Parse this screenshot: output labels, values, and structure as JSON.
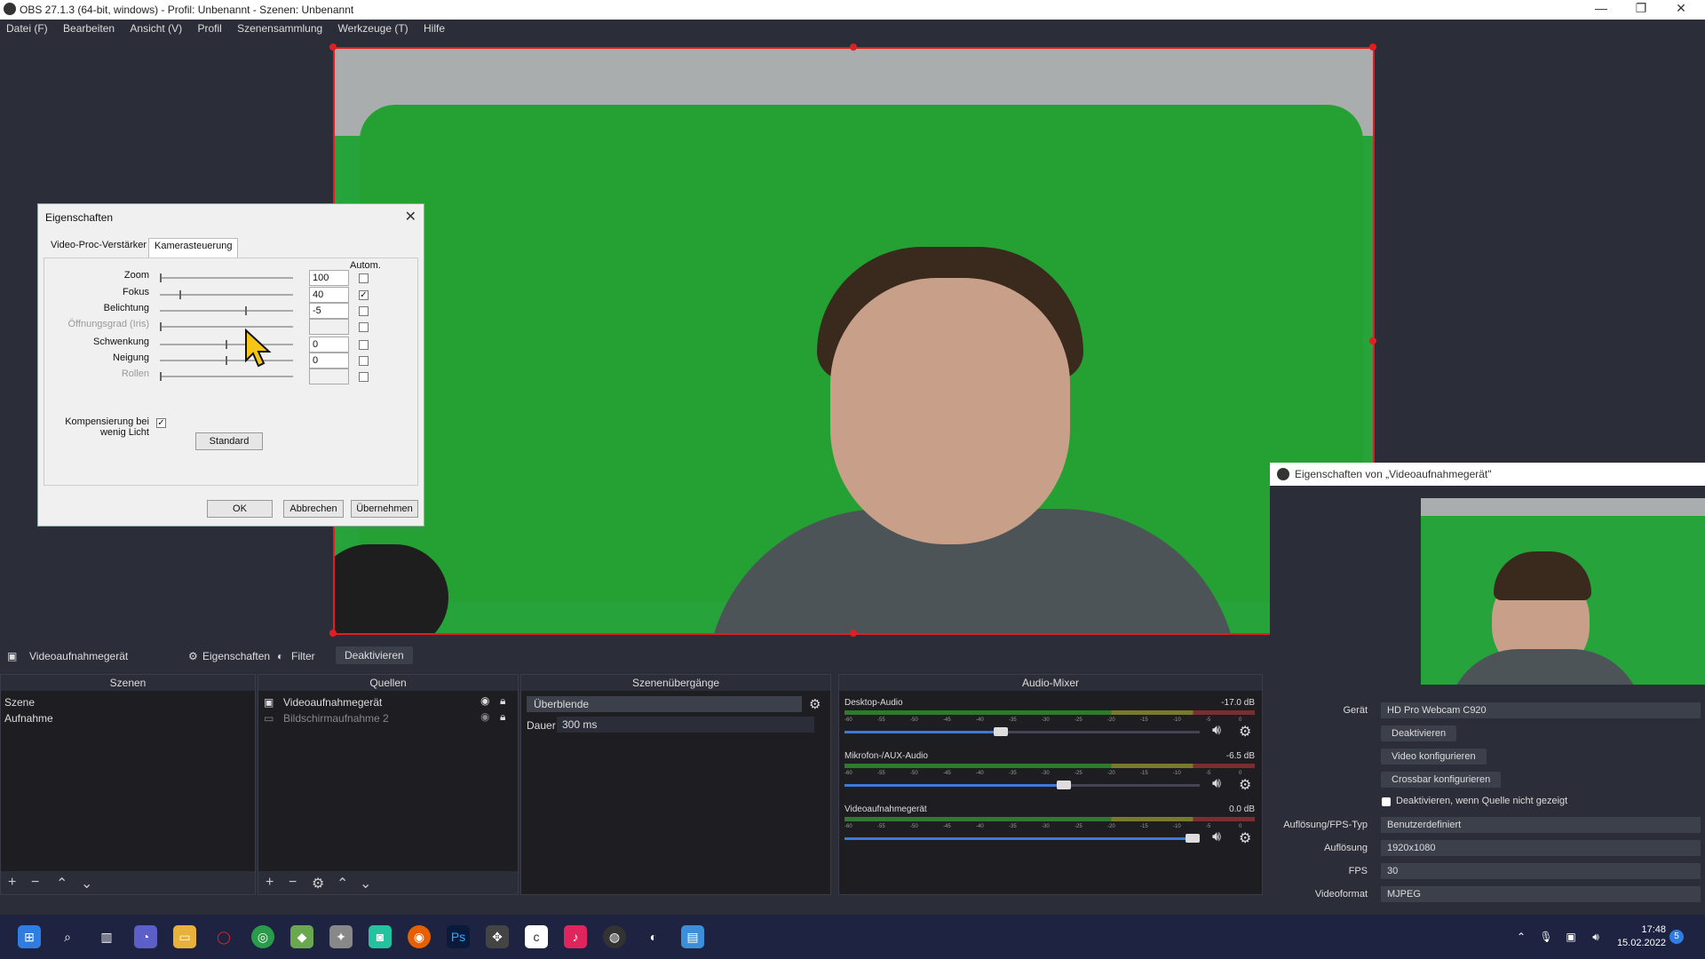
{
  "window": {
    "title": "OBS 27.1.3 (64-bit, windows) - Profil: Unbenannt - Szenen: Unbenannt",
    "controls": [
      "—",
      "❐",
      "✕"
    ]
  },
  "menu": [
    "Datei (F)",
    "Bearbeiten",
    "Ansicht (V)",
    "Profil",
    "Szenensammlung",
    "Werkzeuge (T)",
    "Hilfe"
  ],
  "dialog": {
    "title": "Eigenschaften",
    "tabs": [
      "Video-Proc-Verstärker",
      "Kamerasteuerung"
    ],
    "auto_header": "Autom.",
    "rows": [
      {
        "label": "Zoom",
        "value": "100",
        "checked": false,
        "slider": 0.0,
        "disabled": false
      },
      {
        "label": "Fokus",
        "value": "40",
        "checked": true,
        "slider": 0.15,
        "disabled": false
      },
      {
        "label": "Belichtung",
        "value": "-5",
        "checked": false,
        "slider": 0.65,
        "disabled": false
      },
      {
        "label": "Öffnungsgrad (Iris)",
        "value": "",
        "checked": false,
        "slider": 0.0,
        "disabled": true
      },
      {
        "label": "Schwenkung",
        "value": "0",
        "checked": false,
        "slider": 0.5,
        "disabled": false
      },
      {
        "label": "Neigung",
        "value": "0",
        "checked": false,
        "slider": 0.5,
        "disabled": false
      },
      {
        "label": "Rollen",
        "value": "",
        "checked": false,
        "slider": 0.0,
        "disabled": true
      }
    ],
    "lowlight_label": "Kompensierung bei wenig Licht",
    "lowlight_check": "✓",
    "standard": "Standard",
    "ok": "OK",
    "cancel": "Abbrechen",
    "apply": "Übernehmen"
  },
  "source_bar": {
    "source": "Videoaufnahmegerät",
    "properties": "Eigenschaften",
    "filter": "Filter",
    "deactivate": "Deaktivieren"
  },
  "scenes": {
    "title": "Szenen",
    "items": [
      "Szene",
      "Aufnahme"
    ]
  },
  "sources": {
    "title": "Quellen",
    "items": [
      "Videoaufnahmegerät",
      "Bildschirmaufnahme 2"
    ]
  },
  "transitions": {
    "title": "Szenenübergänge",
    "selected": "Überblende",
    "duration_label": "Dauer",
    "duration": "300 ms"
  },
  "mixer": {
    "title": "Audio-Mixer",
    "scale": [
      "-60",
      "-55",
      "-50",
      "-45",
      "-40",
      "-35",
      "-30",
      "-25",
      "-20",
      "-15",
      "-10",
      "-5",
      "0"
    ],
    "channels": [
      {
        "name": "Desktop-Audio",
        "db": "-17.0 dB",
        "level": 0.45
      },
      {
        "name": "Mikrofon-/AUX-Audio",
        "db": "-6.5 dB",
        "level": 0.63
      },
      {
        "name": "Videoaufnahmegerät",
        "db": "0.0 dB",
        "level": 1.0
      }
    ]
  },
  "properties_panel": {
    "title": "Eigenschaften von „Videoaufnahmegerät\"",
    "device_label": "Gerät",
    "device": "HD Pro Webcam C920",
    "btn_deactivate": "Deaktivieren",
    "btn_video": "Video konfigurieren",
    "btn_crossbar": "Crossbar konfigurieren",
    "deactivate_hidden": "Deaktivieren, wenn Quelle nicht gezeigt",
    "res_type_label": "Auflösung/FPS-Typ",
    "res_type": "Benutzerdefiniert",
    "res_label": "Auflösung",
    "res": "1920x1080",
    "fps_label": "FPS",
    "fps": "30",
    "format_label": "Videoformat",
    "format": "MJPEG"
  },
  "taskbar": {
    "time": "17:48",
    "date": "15.02.2022"
  },
  "colors": {
    "accent": "#3d79d8",
    "selection": "#e02020",
    "greenscreen": "#27a33c"
  }
}
